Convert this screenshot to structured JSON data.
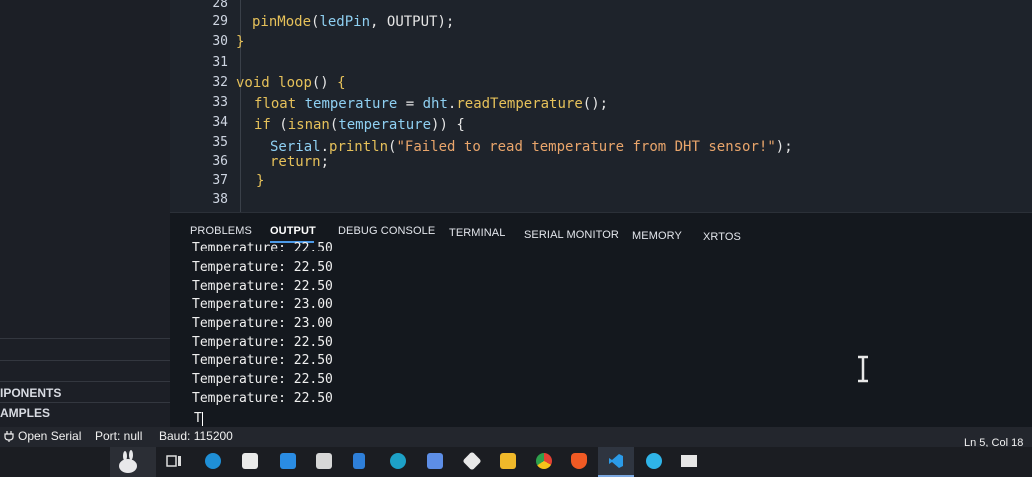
{
  "sidebar": {
    "section1": "IPONENTS",
    "section2": "AMPLES"
  },
  "editor": {
    "lines": [
      {
        "num": "28",
        "code": ""
      },
      {
        "num": "29",
        "code": "pinMode(ledPin, OUTPUT);"
      },
      {
        "num": "30",
        "code": "}"
      },
      {
        "num": "31",
        "code": ""
      },
      {
        "num": "32",
        "code": "void loop() {"
      },
      {
        "num": "33",
        "code": "float temperature = dht.readTemperature();"
      },
      {
        "num": "34",
        "code": "if (isnan(temperature)) {"
      },
      {
        "num": "35",
        "code": "Serial.println(\"Failed to read temperature from DHT sensor!\");"
      },
      {
        "num": "36",
        "code": "return;"
      },
      {
        "num": "37",
        "code": "}"
      },
      {
        "num": "38",
        "code": ""
      }
    ]
  },
  "panel": {
    "tabs": [
      "PROBLEMS",
      "OUTPUT",
      "DEBUG CONSOLE",
      "TERMINAL",
      "SERIAL MONITOR",
      "MEMORY",
      "XRTOS"
    ],
    "active_tab": "OUTPUT",
    "output": [
      "Temperature: 22.50",
      "Temperature: 22.50",
      "Temperature: 22.50",
      "Temperature: 23.00",
      "Temperature: 23.00",
      "Temperature: 22.50",
      "Temperature: 22.50",
      "Temperature: 22.50",
      "Temperature: 22.50"
    ],
    "input_line": "T"
  },
  "statusbar": {
    "open_serial": "Open Serial",
    "port": "Port: null",
    "baud": "Baud: 115200",
    "position": "Ln 5, Col 18"
  },
  "colors": {
    "keyword": "#e6c15a",
    "variable": "#8fd0f2",
    "string": "#e9a56b",
    "tab_underline": "#4d9be8"
  },
  "taskbar": {
    "icons": [
      "task-view-icon",
      "edge-icon",
      "store-icon",
      "mail-icon",
      "folder-icon",
      "download-icon",
      "app-icon",
      "document-icon",
      "git-icon",
      "files-icon",
      "chrome-icon",
      "brave-icon",
      "vscode-icon",
      "app2-icon",
      "network-icon"
    ]
  }
}
